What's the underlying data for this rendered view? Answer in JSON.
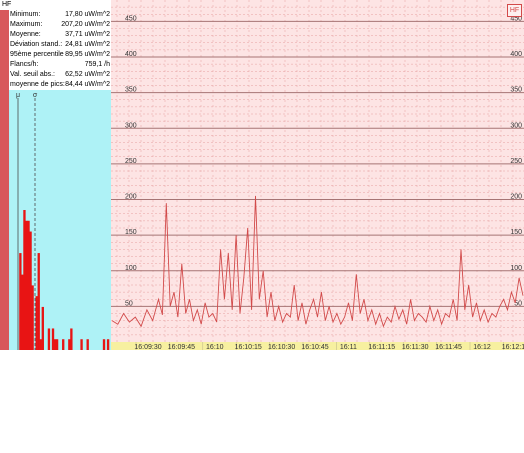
{
  "panel": {
    "title": "HF",
    "stats": [
      {
        "label": "Minimum:",
        "value": "17,80 uW/m^2"
      },
      {
        "label": "Maximum:",
        "value": "207,20 uW/m^2"
      },
      {
        "label": "Moyenne:",
        "value": "37,71 uW/m^2"
      },
      {
        "label": "Déviation stand.:",
        "value": "24,81 uW/m^2"
      },
      {
        "label": "95ème percentile",
        "value": "89,95 uW/m^2"
      },
      {
        "label": "Flancs/h:",
        "value": "759,1 /h"
      },
      {
        "label": "Val. seuil abs.:",
        "value": "62,52 uW/m^2"
      },
      {
        "label": "moyenne de pics:",
        "value": "84,44 uW/m^2"
      }
    ],
    "marker_labels": [
      "μ",
      "σ"
    ]
  },
  "badge": "HF",
  "colors": {
    "series": "#d24b4b",
    "plot_bg": "#fde4e4",
    "histogram_bg": "#aef2f6",
    "histogram_bars": "#e81414",
    "time_axis_bg": "#f7f0a0",
    "major_grid": "#a67474",
    "minor_grid": "#e6a0a0"
  },
  "chart_data": {
    "type": "line",
    "y_ticks": [
      50,
      100,
      150,
      200,
      250,
      300,
      350,
      400,
      450
    ],
    "ylim": [
      0,
      480
    ],
    "x_ticks": [
      "16:09:30",
      "16:09:45",
      "16:10",
      "16:10:15",
      "16:10:30",
      "16:10:45",
      "16:11",
      "16:11:15",
      "16:11:30",
      "16:11:45",
      "16:12",
      "16:12:15"
    ],
    "grid": true,
    "series": [
      {
        "x": [
          0,
          3,
          6,
          9,
          12,
          15,
          18,
          21,
          24,
          26,
          28,
          30,
          32,
          34,
          36,
          38,
          40,
          42,
          44,
          46,
          48,
          50,
          52,
          54,
          56,
          58,
          60,
          62,
          64,
          66,
          68,
          70,
          72,
          74,
          76,
          78,
          80,
          82,
          84,
          86,
          88,
          90,
          92,
          94,
          96,
          98,
          100,
          102,
          104,
          106,
          108,
          110,
          112,
          114,
          116,
          118,
          120,
          122,
          124,
          126,
          128,
          130,
          132,
          134,
          136,
          138,
          140,
          142,
          144,
          146,
          148,
          150,
          152,
          154,
          156,
          158,
          160,
          162,
          164,
          166,
          168,
          170,
          172,
          174,
          176,
          178,
          180,
          182,
          184,
          186,
          188,
          190,
          192,
          194,
          196,
          198,
          200,
          202,
          204,
          206,
          208,
          210,
          212
        ],
        "y": [
          30,
          25,
          40,
          28,
          35,
          22,
          45,
          30,
          60,
          38,
          195,
          50,
          70,
          35,
          110,
          40,
          60,
          30,
          45,
          25,
          55,
          35,
          40,
          28,
          130,
          60,
          125,
          45,
          150,
          40,
          90,
          160,
          45,
          205,
          60,
          100,
          35,
          70,
          30,
          50,
          28,
          40,
          35,
          80,
          30,
          55,
          25,
          45,
          60,
          35,
          70,
          30,
          50,
          28,
          40,
          25,
          35,
          55,
          30,
          95,
          40,
          60,
          30,
          45,
          25,
          40,
          22,
          35,
          28,
          50,
          32,
          45,
          25,
          60,
          30,
          40,
          35,
          28,
          50,
          30,
          45,
          25,
          40,
          35,
          60,
          30,
          130,
          45,
          80,
          35,
          55,
          30,
          45,
          28,
          40,
          35,
          50,
          60,
          45,
          70,
          55,
          90,
          65
        ]
      }
    ]
  }
}
